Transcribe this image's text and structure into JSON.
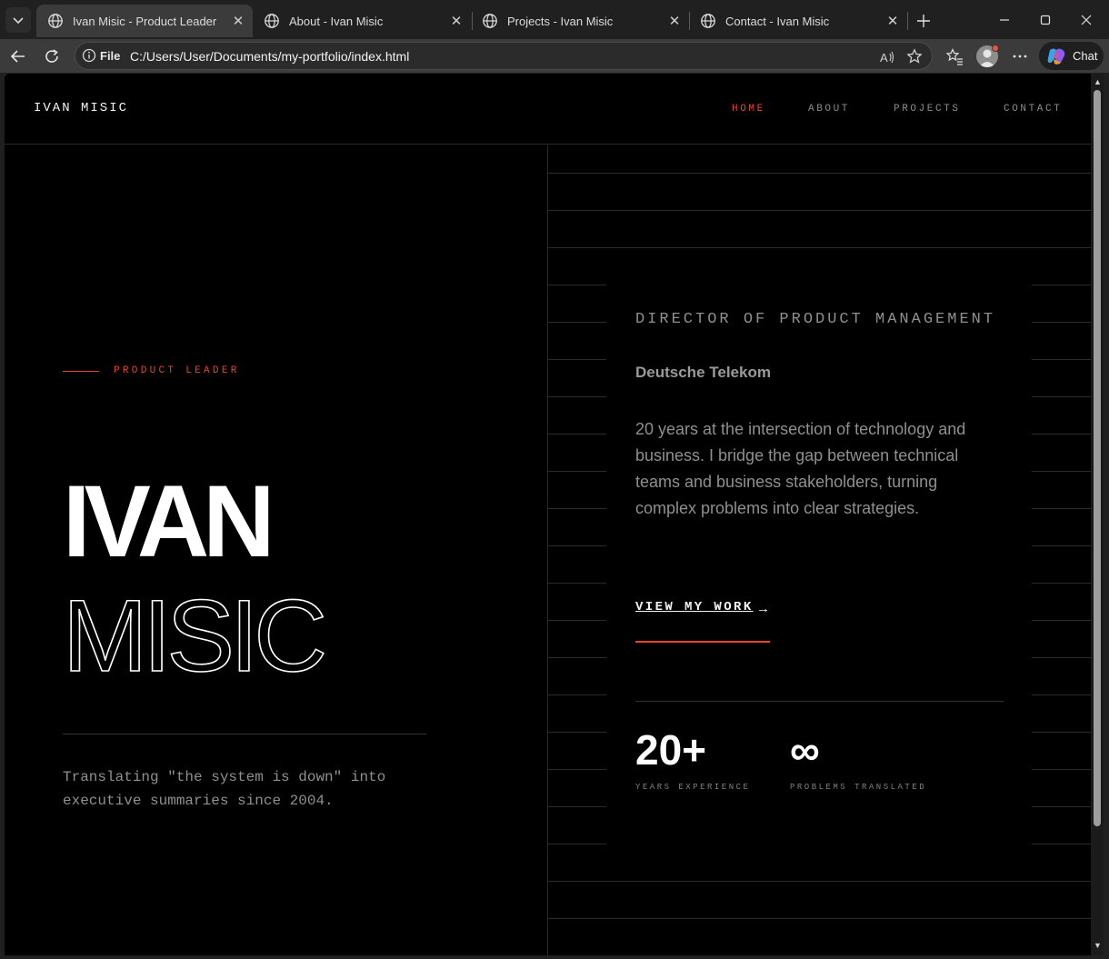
{
  "browser": {
    "tabs": [
      {
        "title": "Ivan Misic - Product Leader",
        "active": true
      },
      {
        "title": "About - Ivan Misic",
        "active": false
      },
      {
        "title": "Projects - Ivan Misic",
        "active": false
      },
      {
        "title": "Contact - Ivan Misic",
        "active": false
      }
    ],
    "address": {
      "scheme_label": "File",
      "url": "C:/Users/User/Documents/my-portfolio/index.html"
    },
    "chat_label": "Chat"
  },
  "site": {
    "logo": "IVAN MISIC",
    "nav": [
      {
        "label": "HOME",
        "active": true
      },
      {
        "label": "ABOUT",
        "active": false
      },
      {
        "label": "PROJECTS",
        "active": false
      },
      {
        "label": "CONTACT",
        "active": false
      }
    ],
    "hero": {
      "eyebrow": "PRODUCT LEADER",
      "first_name": "IVAN",
      "last_name": "MISIC",
      "tagline": "Translating \"the system is down\" into executive summaries since 2004."
    },
    "card": {
      "role": "DIRECTOR OF PRODUCT MANAGEMENT",
      "company": "Deutsche Telekom",
      "bio": "20 years at the intersection of technology and business. I bridge the gap between technical teams and business stakeholders, turning complex problems into clear strategies.",
      "cta": "VIEW MY WORK",
      "cta_icon": "arrow-right-icon",
      "stats": [
        {
          "value": "20+",
          "label": "YEARS EXPERIENCE"
        },
        {
          "value": "∞",
          "label": "PROBLEMS TRANSLATED"
        }
      ]
    }
  },
  "colors": {
    "accent": "#e8452f",
    "background": "#000000",
    "text": "#f2f2f2",
    "muted": "#8f8f8f"
  }
}
